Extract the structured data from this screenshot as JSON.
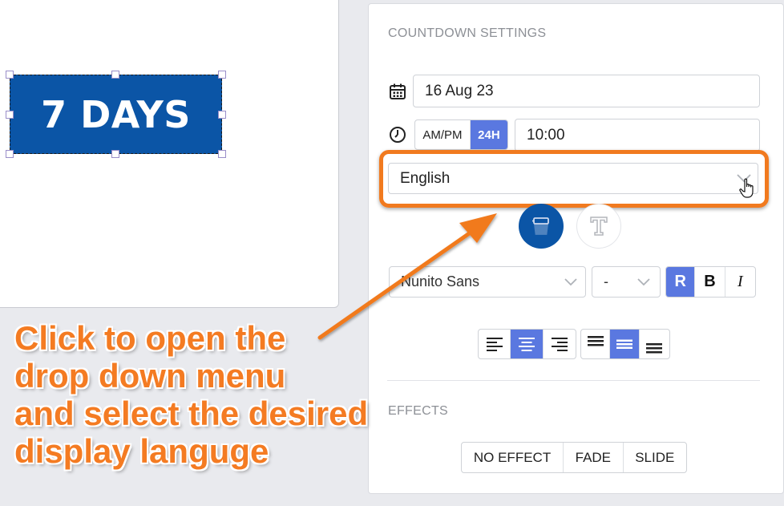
{
  "canvas": {
    "banner_text": "7 DAYS",
    "banner_color": "#0b55a6"
  },
  "panel": {
    "title": "COUNTDOWN SETTINGS",
    "date_value": "16 Aug 23",
    "time_format": {
      "ampm_label": "AM/PM",
      "h24_label": "24H",
      "selected": "24H"
    },
    "time_value": "10:00",
    "language_value": "English",
    "font_family_value": "Nunito Sans",
    "font_size_value": "-",
    "style_buttons": {
      "regular": "R",
      "bold": "B",
      "italic": "I",
      "selected": "R"
    },
    "accent_color": "#5a78e0",
    "effects_title": "EFFECTS",
    "effects": [
      "NO EFFECT",
      "FADE",
      "SLIDE"
    ]
  },
  "annotation": {
    "lines": [
      "Click to open the",
      "drop down menu",
      "and select the desired",
      "display languge"
    ],
    "color": "#f47b22"
  }
}
